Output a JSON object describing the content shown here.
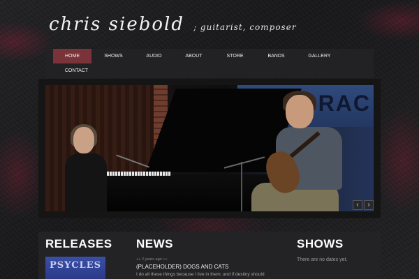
{
  "header": {
    "name": "chris siebold",
    "tagline": "; guitarist, composer"
  },
  "nav": {
    "items": [
      {
        "label": "Home",
        "active": true
      },
      {
        "label": "Shows",
        "active": false
      },
      {
        "label": "Audio",
        "active": false
      },
      {
        "label": "About",
        "active": false
      },
      {
        "label": "Store",
        "active": false
      },
      {
        "label": "Bands",
        "active": false
      },
      {
        "label": "Gallery",
        "active": false
      },
      {
        "label": "Contact",
        "active": false
      }
    ]
  },
  "slider": {
    "prev_icon": "chevron-left-icon",
    "next_icon": "chevron-right-icon",
    "prev_glyph": "‹",
    "next_glyph": "›",
    "banner_text": "RAC"
  },
  "releases": {
    "title": "RELEASES",
    "cover_text": "PSYCLES"
  },
  "news": {
    "title": "NEWS",
    "meta": "++ 2 years ago ++",
    "post_title": "(PLACEHOLDER) DOGS AND CATS",
    "excerpt": "I do all these things because I live in them; and if destiny should"
  },
  "shows": {
    "title": "SHOWS",
    "empty": "There are no dates yet."
  },
  "colors": {
    "accent": "#7a3439",
    "background": "#1b1b1d",
    "panel": "#232325"
  }
}
